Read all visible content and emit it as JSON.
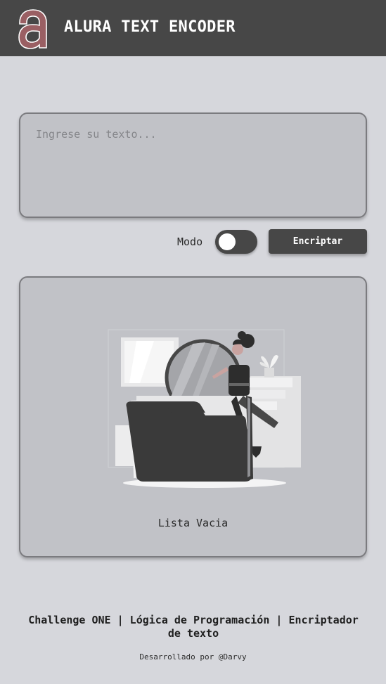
{
  "header": {
    "title": "ALURA TEXT ENCODER",
    "logo_icon": "alura-a-logo-icon"
  },
  "input": {
    "placeholder": "Ingrese su texto...",
    "value": ""
  },
  "controls": {
    "mode_label": "Modo",
    "toggle_state": "off",
    "encrypt_label": "Encriptar"
  },
  "output": {
    "empty_text": "Lista Vacia",
    "illustration_icon": "empty-folder-illustration"
  },
  "footer": {
    "title": "Challenge ONE | Lógica de Programación | Encriptador de texto",
    "credit": "Desarrollado por @Darvy"
  },
  "colors": {
    "background": "#d6d7dc",
    "header": "#474747",
    "panel": "#c1c2c7",
    "accent": "#474747",
    "logo_fill": "#9a5f63"
  }
}
